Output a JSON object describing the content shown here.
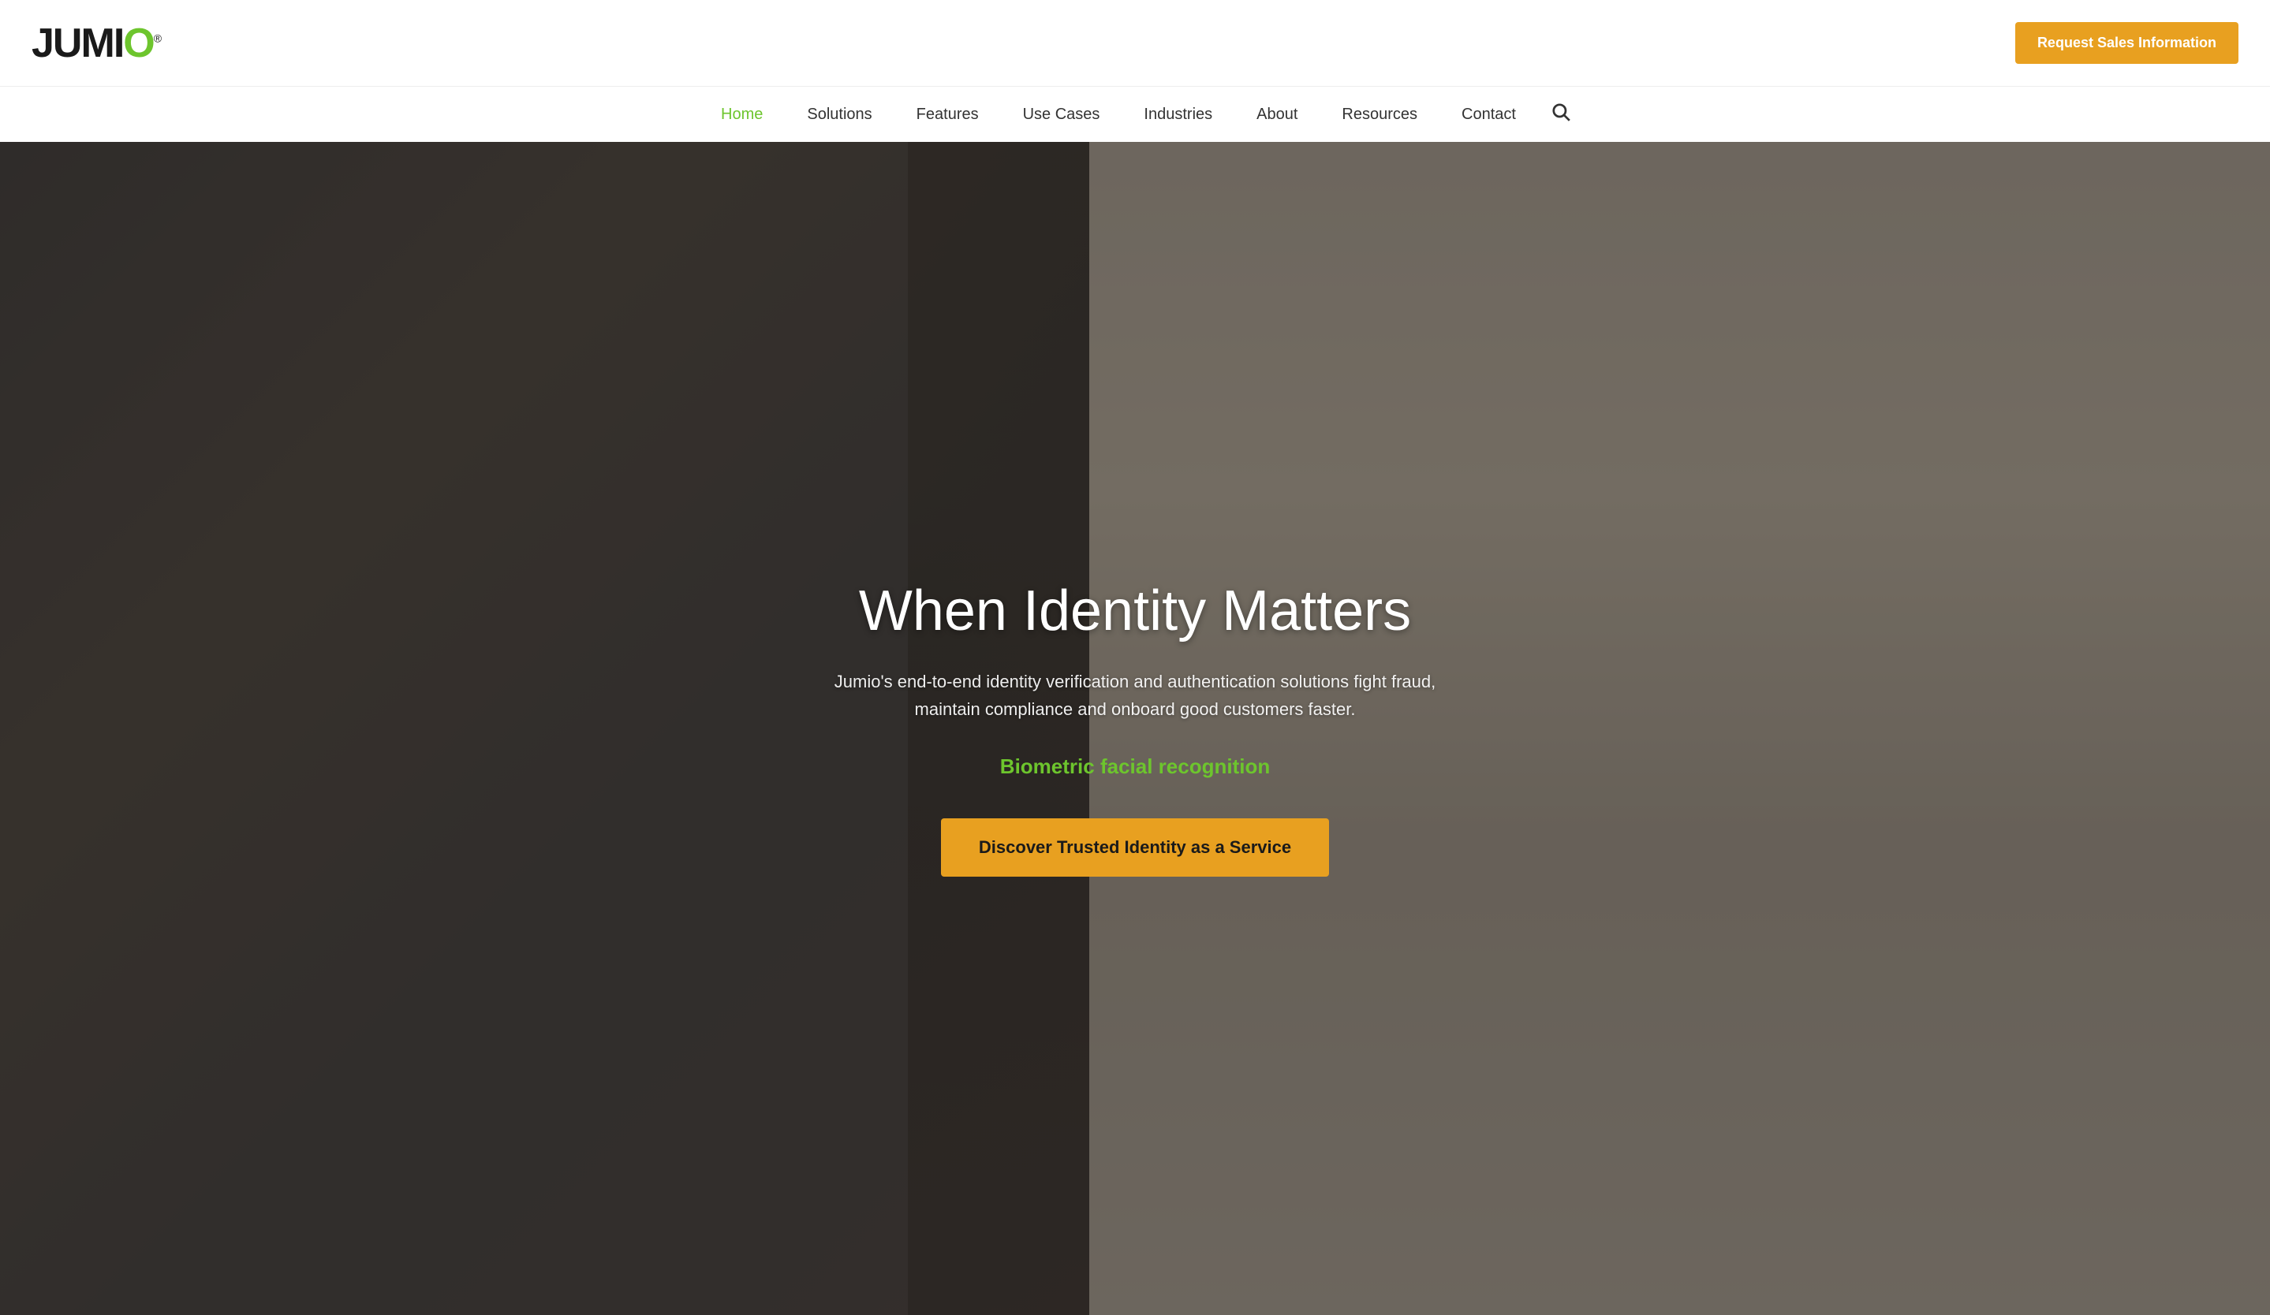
{
  "header": {
    "logo": {
      "text": "JUMIO",
      "reg_symbol": "®"
    },
    "cta_button": "Request Sales Information"
  },
  "nav": {
    "items": [
      {
        "label": "Home",
        "active": true
      },
      {
        "label": "Solutions",
        "active": false
      },
      {
        "label": "Features",
        "active": false
      },
      {
        "label": "Use Cases",
        "active": false
      },
      {
        "label": "Industries",
        "active": false
      },
      {
        "label": "About",
        "active": false
      },
      {
        "label": "Resources",
        "active": false
      },
      {
        "label": "Contact",
        "active": false
      }
    ]
  },
  "hero": {
    "title": "When Identity Matters",
    "subtitle": "Jumio's end-to-end identity verification and authentication solutions fight fraud, maintain compliance and onboard good customers faster.",
    "feature_text": "Biometric facial recognition",
    "cta_button": "Discover Trusted Identity as a Service"
  },
  "colors": {
    "green": "#6dc52d",
    "orange": "#e8a020",
    "dark": "#1a1a1a",
    "white": "#ffffff"
  }
}
